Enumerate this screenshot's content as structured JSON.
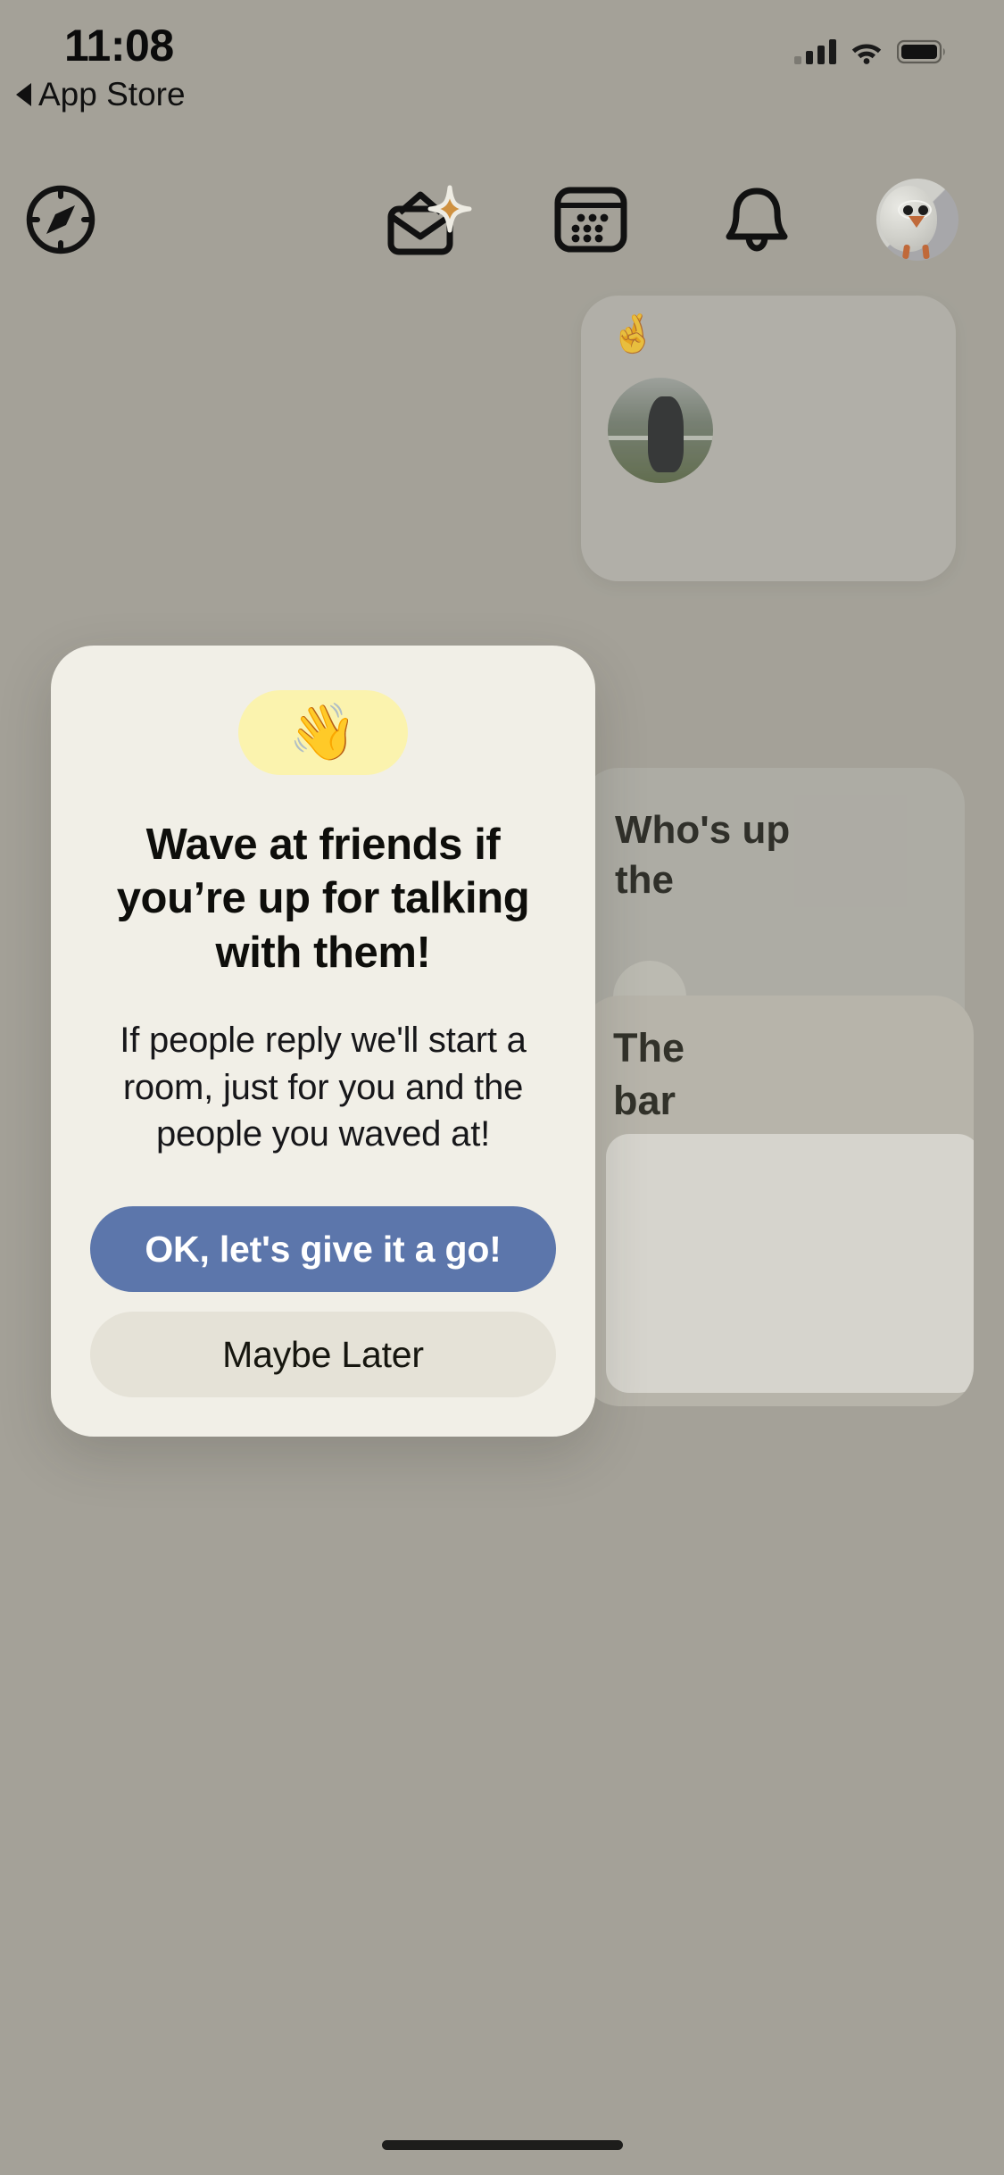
{
  "status_bar": {
    "time": "11:08",
    "back_label": "App Store",
    "back_icon": "back-caret-icon",
    "signal_icon": "cellular-signal-icon",
    "wifi_icon": "wifi-icon",
    "battery_icon": "battery-full-icon"
  },
  "nav_bar": {
    "items": [
      {
        "name": "explore",
        "icon": "compass-icon"
      },
      {
        "name": "invites",
        "icon": "envelope-sparkle-icon"
      },
      {
        "name": "calendar",
        "icon": "calendar-icon"
      },
      {
        "name": "notifications",
        "icon": "bell-icon"
      },
      {
        "name": "profile",
        "icon": "avatar-bird-icon"
      }
    ]
  },
  "background_cards": [
    {
      "emoji": "🤞",
      "photo": "user-photo-avatar"
    },
    {
      "text": "Who's up\nthe",
      "avatar_emoji": "👤"
    },
    {
      "text": "The\nbar",
      "doc": "document-preview"
    }
  ],
  "modal": {
    "emoji": "👋",
    "emoji_name": "waving-hand",
    "title": "Wave at friends if you’re up for talking with them!",
    "body": "If people reply we'll start a room, just for you and the people you waved at!",
    "primary_button": "OK, let's give it a go!",
    "secondary_button": "Maybe Later"
  },
  "colors": {
    "background": "#a8a59c",
    "modal_background": "#f1efe7",
    "primary_button": "#5c76ab",
    "secondary_button": "#e5e2d7",
    "emoji_pill": "#fbf3ae",
    "text": "#0e0e0b"
  },
  "home_indicator": "home-indicator"
}
